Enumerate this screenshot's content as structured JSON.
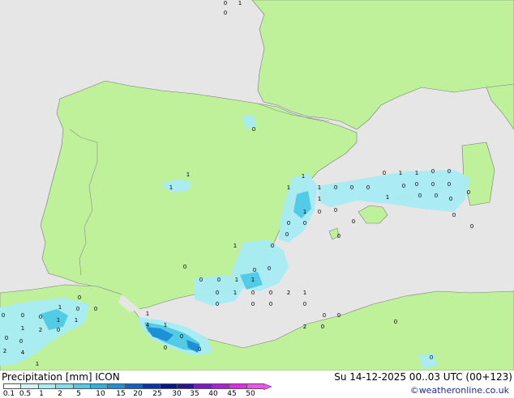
{
  "header": {
    "product": "Precipitation [mm]",
    "model": "ICON",
    "valid_time": "Su 14-12-2025 00..03 UTC (00+123)"
  },
  "credit": "©weatheronline.co.uk",
  "legend": {
    "ticks": [
      "0.1",
      "0.5",
      "1",
      "2",
      "5",
      "10",
      "15",
      "20",
      "25",
      "30",
      "35",
      "40",
      "45",
      "50"
    ],
    "colors": [
      "#ffffff",
      "#d0f4f8",
      "#a8ecf4",
      "#7ee0ef",
      "#52cbe6",
      "#30b2de",
      "#1f8fd6",
      "#1060c6",
      "#0836a8",
      "#04168c",
      "#2a1496",
      "#7a18c4",
      "#b01ed8",
      "#e02aea",
      "#f44ef4"
    ],
    "icons": [
      "arrow-right-icon"
    ]
  },
  "map_colors": {
    "sea": "#e6e6e6",
    "land": "#bff19a",
    "coast": "#7a7a7a",
    "border": "#8a8a8a"
  },
  "labels": [
    "0",
    "1",
    "0",
    "0",
    "1",
    "1",
    "1",
    "1",
    "1",
    "0",
    "0",
    "0",
    "0",
    "1",
    "1",
    "0",
    "0",
    "0",
    "0",
    "0",
    "0",
    "1",
    "0",
    "0",
    "0",
    "0",
    "0",
    "1",
    "1",
    "0",
    "0",
    "0",
    "0",
    "0",
    "0",
    "0",
    "0",
    "1",
    "0",
    "0",
    "0",
    "0",
    "0",
    "1",
    "0",
    "0",
    "1",
    "0",
    "0",
    "1",
    "2",
    "1",
    "0",
    "0",
    "0",
    "0",
    "2",
    "0",
    "0",
    "0",
    "1",
    "4",
    "1",
    "0",
    "0",
    "0",
    "0",
    "0",
    "0",
    "0",
    "1",
    "0",
    "0",
    "1",
    "1",
    "1",
    "0",
    "0",
    "2",
    "0",
    "4",
    "1",
    "2",
    "0",
    "0"
  ]
}
